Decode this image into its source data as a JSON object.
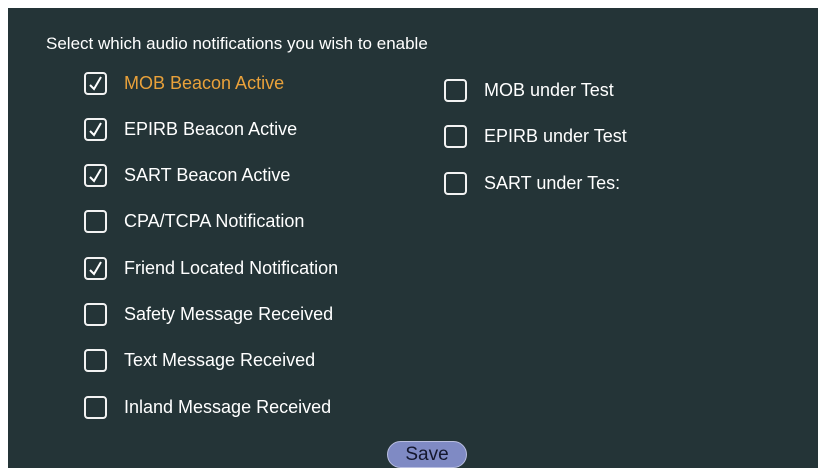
{
  "heading": "Select which audio notifications you wish to enable",
  "left_options": [
    {
      "label": "MOB Beacon Active",
      "checked": true,
      "highlighted": true
    },
    {
      "label": "EPIRB Beacon Active",
      "checked": true,
      "highlighted": false
    },
    {
      "label": "SART Beacon Active",
      "checked": true,
      "highlighted": false
    },
    {
      "label": "CPA/TCPA  Notification",
      "checked": false,
      "highlighted": false
    },
    {
      "label": "Friend Located Notification",
      "checked": true,
      "highlighted": false
    },
    {
      "label": "Safety Message Received",
      "checked": false,
      "highlighted": false
    },
    {
      "label": "Text Message Received",
      "checked": false,
      "highlighted": false
    },
    {
      "label": "Inland Message Received",
      "checked": false,
      "highlighted": false
    }
  ],
  "right_options": [
    {
      "label": "MOB under Test",
      "checked": false
    },
    {
      "label": "EPIRB under Test",
      "checked": false
    },
    {
      "label": "SART under Tes:",
      "checked": false
    }
  ],
  "save_label": "Save",
  "colors": {
    "background": "#243437",
    "highlight": "#e9a13a",
    "save_button": "#7f8ac4"
  }
}
